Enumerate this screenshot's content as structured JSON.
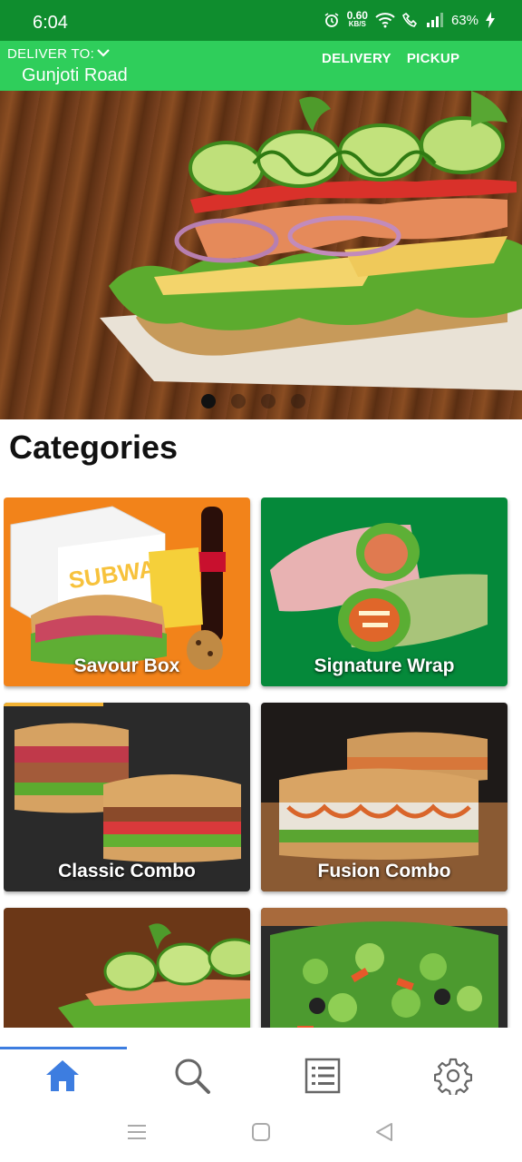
{
  "status_bar": {
    "time": "6:04",
    "net_speed": "0.60",
    "net_unit": "KB/S",
    "battery": "63%"
  },
  "header": {
    "deliver_label": "DELIVER TO:",
    "address": "Gunjoti Road",
    "tabs": [
      {
        "label": "DELIVERY"
      },
      {
        "label": "PICKUP"
      }
    ]
  },
  "banner": {
    "slide_count": 4,
    "active_slide": 0
  },
  "categories": {
    "title": "Categories",
    "items": [
      {
        "label": "Savour Box",
        "bg": "#f2831a"
      },
      {
        "label": "Signature Wrap",
        "bg": "#05893a"
      },
      {
        "label": "Classic Combo",
        "bg": "#2a2a2a"
      },
      {
        "label": "Fusion Combo",
        "bg": "#1e1a18"
      },
      {
        "label": "",
        "bg": "#6b3717"
      },
      {
        "label": "",
        "bg": "#2b2b2b"
      }
    ]
  },
  "bottom_nav": {
    "items": [
      {
        "icon": "home-icon",
        "active": true
      },
      {
        "icon": "search-icon",
        "active": false
      },
      {
        "icon": "list-icon",
        "active": false
      },
      {
        "icon": "gear-icon",
        "active": false
      }
    ]
  },
  "colors": {
    "status_bar": "#0f8d2e",
    "header": "#2fce5b",
    "accent": "#3d7de0"
  }
}
